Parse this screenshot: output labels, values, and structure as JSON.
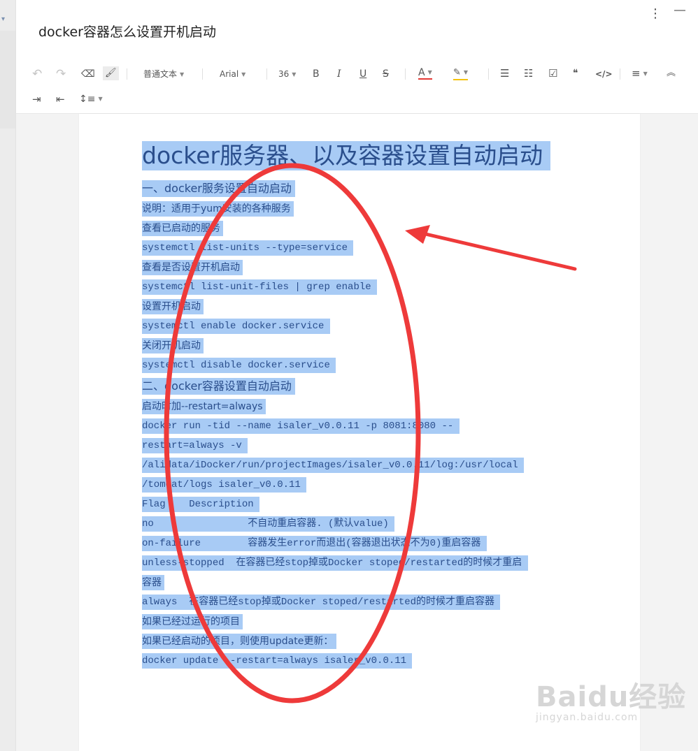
{
  "app": {
    "doc_title": "docker容器怎么设置开机启动",
    "more_icon": "⋮",
    "minimize_icon": "—"
  },
  "toolbar": {
    "undo": "↶",
    "redo": "↷",
    "eraser": "⌫",
    "format_painter": "🖌",
    "paragraph_style": "普通文本",
    "font_family": "Arial",
    "font_size": "36",
    "bold": "B",
    "italic": "I",
    "underline": "U",
    "strike": "S",
    "font_color": "A",
    "highlight": "✎",
    "bullet_list": "☰",
    "numbered_list": "☷",
    "checkbox": "☑",
    "quote": "❝",
    "code": "</>",
    "align": "≡",
    "collapse": "︽",
    "indent_increase": "⇥",
    "indent_decrease": "⇤",
    "line_height": "↕≡",
    "accent_color": "#e53935",
    "highlight_color": "#f4c20d"
  },
  "document": {
    "title": "docker服务器、以及容器设置自动启动 ",
    "lines": [
      "一、docker服务设置自动启动 ",
      "说明：适用于yum安装的各种服务 ",
      "查看已启动的服务 ",
      "systemctl list-units --type=service ",
      "查看是否设置开机启动 ",
      "systemctl list-unit-files | grep enable ",
      "设置开机启动 ",
      "systemctl enable docker.service ",
      "关闭开机启动 ",
      "systemctl disable docker.service ",
      "二、docker容器设置自动启动 ",
      "启动时加--restart=always ",
      "docker run -tid --name isaler_v0.0.11 -p 8081:8080 -- ",
      "restart=always -v ",
      "/alidata/iDocker/run/projectImages/isaler_v0.0.11/log:/usr/local ",
      "/tomcat/logs isaler_v0.0.11 ",
      "Flag    Description ",
      "no                不自动重启容器. (默认value) ",
      "on-failure        容器发生error而退出(容器退出状态不为0)重启容器 ",
      "unless-stopped  在容器已经stop掉或Docker stoped/restarted的时候才重启 ",
      "容器 ",
      "always  在容器已经stop掉或Docker stoped/restarted的时候才重启容器 ",
      "如果已经过运行的项目 ",
      "如果已经启动的项目，则使用update更新： ",
      "docker update --restart=always isaler_v0.0.11 "
    ]
  },
  "annotation": {
    "ellipse_color": "#ee3a3a",
    "arrow_color": "#ee3a3a"
  },
  "watermark": {
    "brand": "Baidu经验",
    "url": "jingyan.baidu.com"
  }
}
